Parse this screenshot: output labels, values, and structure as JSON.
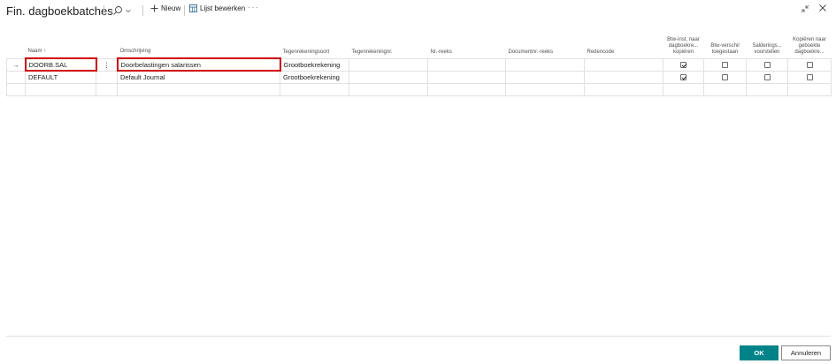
{
  "header": {
    "title": "Fin. dagboekbatches",
    "new_label": "Nieuw",
    "edit_list_label": "Lijst bewerken",
    "more_label": "···"
  },
  "grid": {
    "columns": [
      {
        "label": "Naam ↑"
      },
      {
        "label": ""
      },
      {
        "label": "Omschrijving"
      },
      {
        "label": "Tegenrekeningsoort"
      },
      {
        "label": "Tegenrekeningnr."
      },
      {
        "label": "Nr.-reeks"
      },
      {
        "label": "Documentnr.-reeks"
      },
      {
        "label": "Redencode"
      },
      {
        "label": "Btw-inst. naar dagboekre... kopiëren"
      },
      {
        "label": "Btw-verschil toegestaan"
      },
      {
        "label": "Salderings... voorstellen"
      },
      {
        "label": "Kopiëren naar geboekte dagboekre..."
      }
    ],
    "rows": [
      {
        "indicator": "→",
        "naam": "DOORB.SAL",
        "dots": "⋮",
        "omschrijving": "Doorbelastingen salarissen",
        "tegenrekeningsoort": "Grootboekrekening",
        "tegenrekeningnr": "",
        "nr_reeks": "",
        "documentnr_reeks": "",
        "redencode": "",
        "btw_kopieren": true,
        "btw_verschil": false,
        "saldering": false,
        "kopieren_geboekt": false
      },
      {
        "indicator": "",
        "naam": "DEFAULT",
        "dots": "",
        "omschrijving": "Default Journal",
        "tegenrekeningsoort": "Grootboekrekening",
        "tegenrekeningnr": "",
        "nr_reeks": "",
        "documentnr_reeks": "",
        "redencode": "",
        "btw_kopieren": true,
        "btw_verschil": false,
        "saldering": false,
        "kopieren_geboekt": false
      }
    ]
  },
  "footer": {
    "ok_label": "OK",
    "cancel_label": "Annuleren"
  },
  "colors": {
    "accent": "#008489",
    "highlight": "#d00000"
  }
}
